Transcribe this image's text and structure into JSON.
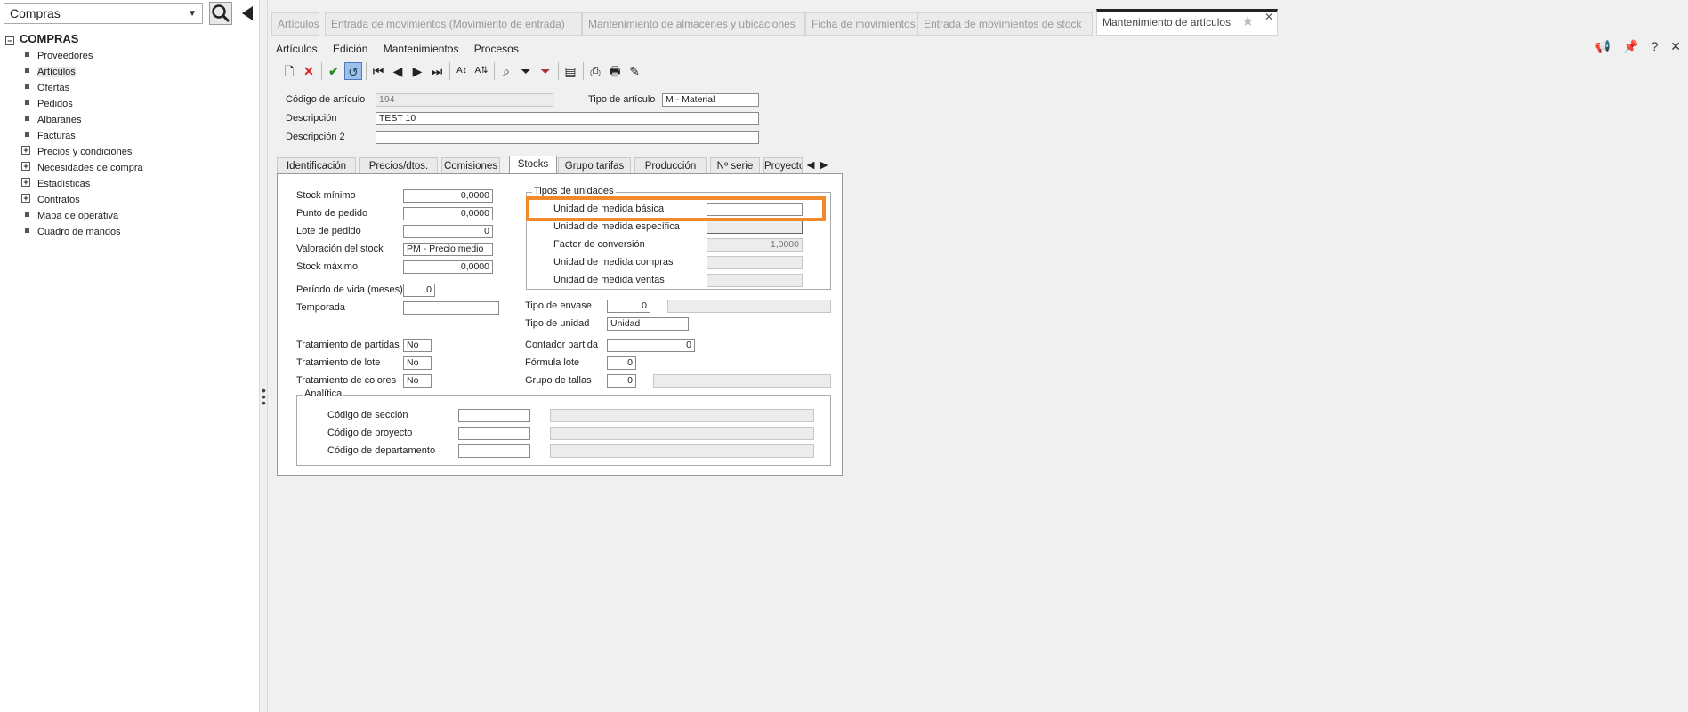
{
  "nav": {
    "module": "Compras",
    "root": "COMPRAS",
    "items": [
      {
        "label": "Proveedores",
        "expandable": false
      },
      {
        "label": "Artículos",
        "expandable": false,
        "selected": true
      },
      {
        "label": "Ofertas",
        "expandable": false
      },
      {
        "label": "Pedidos",
        "expandable": false
      },
      {
        "label": "Albaranes",
        "expandable": false
      },
      {
        "label": "Facturas",
        "expandable": false
      },
      {
        "label": "Precios y condiciones",
        "expandable": true
      },
      {
        "label": "Necesidades de compra",
        "expandable": true
      },
      {
        "label": "Estadísticas",
        "expandable": true
      },
      {
        "label": "Contratos",
        "expandable": true
      },
      {
        "label": "Mapa de operativa",
        "expandable": false
      },
      {
        "label": "Cuadro de mandos",
        "expandable": false
      }
    ]
  },
  "doc_tabs": [
    "Artículos",
    "Entrada de movimientos (Movimiento de entrada)",
    "Mantenimiento de almacenes y ubicaciones",
    "Ficha de movimientos",
    "Entrada de movimientos de stock",
    "Mantenimiento de artículos"
  ],
  "menu": [
    "Artículos",
    "Edición",
    "Mantenimientos",
    "Procesos"
  ],
  "header": {
    "codigo_label": "Código de artículo",
    "codigo_value": "194",
    "tipo_label": "Tipo de artículo",
    "tipo_value": "M  - Material",
    "desc_label": "Descripción",
    "desc_value": "TEST 10",
    "desc2_label": "Descripción 2",
    "desc2_value": ""
  },
  "subtabs": [
    "Identificación",
    "Precios/dtos.",
    "Comisiones",
    "Stocks",
    "Grupo tarifas",
    "Producción",
    "Nº serie",
    "Proyectos"
  ],
  "stocks": {
    "stock_minimo": {
      "label": "Stock mínimo",
      "value": "0,0000"
    },
    "punto_pedido": {
      "label": "Punto de pedido",
      "value": "0,0000"
    },
    "lote_pedido": {
      "label": "Lote de pedido",
      "value": "0"
    },
    "valoracion": {
      "label": "Valoración del stock",
      "value": "PM  - Precio medio"
    },
    "stock_maximo": {
      "label": "Stock máximo",
      "value": "0,0000"
    },
    "periodo_vida": {
      "label": "Período de vida (meses)",
      "value": "0"
    },
    "temporada": {
      "label": "Temporada",
      "value": ""
    },
    "trat_partidas": {
      "label": "Tratamiento de partidas",
      "value": "No"
    },
    "trat_lote": {
      "label": "Tratamiento de lote",
      "value": "No"
    },
    "trat_colores": {
      "label": "Tratamiento de colores",
      "value": "No"
    },
    "tipos_unidades": {
      "title": "Tipos de unidades",
      "basica": {
        "label": "Unidad de medida básica",
        "value": ""
      },
      "especifica": {
        "label": "Unidad de medida específica",
        "value": ""
      },
      "factor": {
        "label": "Factor de conversión",
        "value": "1,0000"
      },
      "compras": {
        "label": "Unidad de medida compras",
        "value": ""
      },
      "ventas": {
        "label": "Unidad de medida ventas",
        "value": ""
      }
    },
    "tipo_envase": {
      "label": "Tipo de envase",
      "value": "0"
    },
    "tipo_unidad": {
      "label": "Tipo de unidad",
      "value": "Unidad"
    },
    "contador_partida": {
      "label": "Contador partida",
      "value": "0"
    },
    "formula_lote": {
      "label": "Fórmula lote",
      "value": "0"
    },
    "grupo_tallas": {
      "label": "Grupo de tallas",
      "value": "0"
    },
    "analitica": {
      "title": "Analítica",
      "seccion": {
        "label": "Código de sección",
        "value": ""
      },
      "proyecto": {
        "label": "Código de  proyecto",
        "value": ""
      },
      "departamento": {
        "label": "Código de  departamento",
        "value": ""
      }
    }
  },
  "accent": "#f08a2c"
}
